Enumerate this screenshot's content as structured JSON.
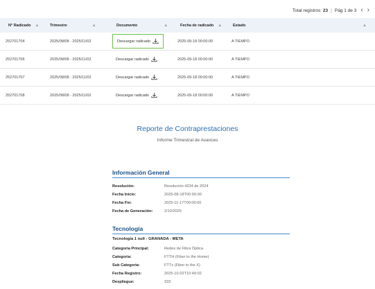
{
  "pager": {
    "total_label": "Total registros:",
    "total_value": "23",
    "page_label": "Pág 1 de 3",
    "prev": "‹",
    "next": "›"
  },
  "table": {
    "columns": [
      "N° Radicado",
      "Trimestre",
      "Documento",
      "Fecha de radicado",
      "Estado"
    ],
    "rows": [
      {
        "radicado": "252701704",
        "trimestre": "2025/08/08 - 2025/11/02",
        "documento": "Descargar radicado",
        "fecha": "2025-09-18 00:00:00",
        "estado": "A TIEMPO"
      },
      {
        "radicado": "252701706",
        "trimestre": "2025/08/08 - 2025/11/02",
        "documento": "Descargar radicado",
        "fecha": "2025-09-18 00:00:00",
        "estado": "A TIEMPO"
      },
      {
        "radicado": "252701707",
        "trimestre": "2025/08/08 - 2025/11/02",
        "documento": "Descargar radicado",
        "fecha": "2025-09-18 00:00:00",
        "estado": "A TIEMPO"
      },
      {
        "radicado": "252701708",
        "trimestre": "2025/08/08 - 2025/11/02",
        "documento": "Descargar radicado",
        "fecha": "2025-09-18 00:00:00",
        "estado": "A TIEMPO"
      }
    ]
  },
  "report": {
    "title": "Reporte de Contraprestaciones",
    "subtitle": "Informe Trimestral de Avances",
    "general": {
      "heading": "Información General",
      "items": [
        {
          "k": "Resolución:",
          "v": "Resolución 4224 de 2024"
        },
        {
          "k": "Fecha Inicio:",
          "v": "2025-08-18T00:00:00"
        },
        {
          "k": "Fecha Fin:",
          "v": "2025-11-17T00:00:00"
        },
        {
          "k": "Fecha de Generación:",
          "v": "2/10/2025"
        }
      ]
    },
    "tecnologia": {
      "heading": "Tecnología",
      "subheading": "Tecnologia 1 null - GRANADA - META",
      "items": [
        {
          "k": "Categoria Principal:",
          "v": "Redes de Fibra Óptica"
        },
        {
          "k": "Categoria:",
          "v": "FTTH (Fiber to the Home)"
        },
        {
          "k": "Sub Categoria:",
          "v": "FTTx (Fiber to the X)"
        },
        {
          "k": "Fecha Registro:",
          "v": "2025-10-02T10:49:02"
        },
        {
          "k": "Despliegue:",
          "v": "333"
        }
      ]
    }
  },
  "colors": {
    "accent_blue": "#2a6fb4",
    "section_blue": "#1a4f86",
    "active_border": "#6cc04a",
    "header_bg": "#edf2f8"
  }
}
